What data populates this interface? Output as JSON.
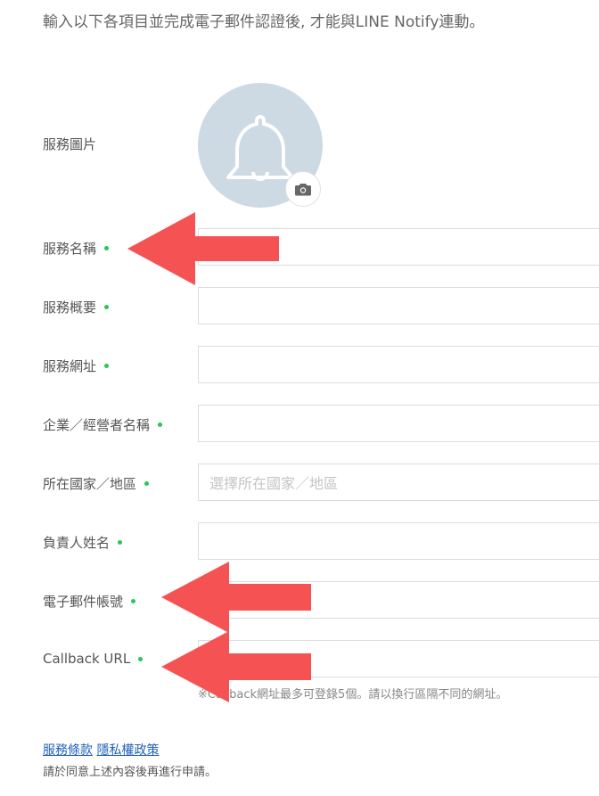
{
  "intro": "輸入以下各項目並完成電子郵件認證後, 才能與LINE Notify連動。",
  "icon": {
    "avatar": "bell-icon",
    "camera": "camera-icon",
    "accent": "#2bc45c",
    "arrow_color": "#f55353",
    "avatar_bg": "#cdd9e3"
  },
  "form": {
    "image_label": "服務圖片",
    "service_name_label": "服務名稱",
    "service_summary_label": "服務概要",
    "service_url_label": "服務網址",
    "company_label": "企業／經營者名稱",
    "country_label": "所在國家／地區",
    "country_placeholder": "選擇所在國家／地區",
    "person_label": "負責人姓名",
    "email_label": "電子郵件帳號",
    "callback_label": "Callback URL",
    "callback_hint": "※Callback網址最多可登錄5個。請以換行區隔不同的網址。"
  },
  "footer": {
    "terms_link": "服務條款",
    "privacy_link": "隱私權政策",
    "consent_note": "請於同意上述內容後再進行申請。"
  }
}
